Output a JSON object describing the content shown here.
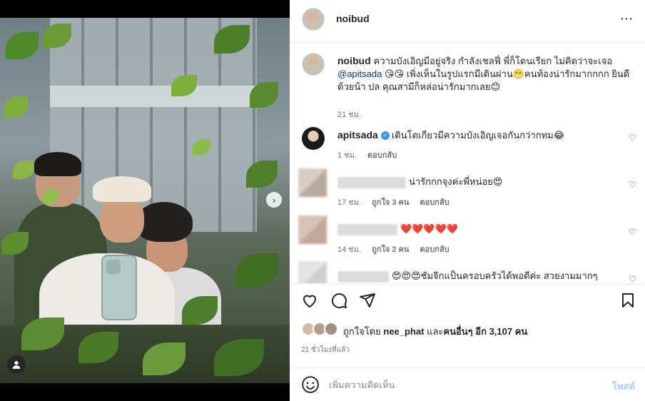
{
  "post": {
    "author": "noibud",
    "more_icon": "⋯"
  },
  "caption": {
    "author": "noibud",
    "text_1": "ความบังเอิญมีอยู่จริง กำลังเชลฟี่ พี่ก็โดนเรียก ไม่คิดว่าจะเจอ",
    "mention": "@apitsada",
    "text_2": "😘😘 เพิ่งเห็นในรูปแรกมีเดินผ่าน😬คนท้องน่ารักมากกกก ยินดีด้วยน้า ปล คุณสามีก็หล่อน่ารักมากเลย😊",
    "time": "21 ชม."
  },
  "comments": [
    {
      "author": "apitsada",
      "verified": true,
      "text": "เดินโตเกียวมีความบังเอิญเจอกันกว่ากทม😂",
      "time": "1 ชม.",
      "reply_label": "ตอบกลับ"
    },
    {
      "author_hidden": true,
      "text": "น่ารักกกจุงค่ะพี่หน่อย😍",
      "time": "17 ชม.",
      "likes": "ถูกใจ 3 คน",
      "reply_label": "ตอบกลับ"
    },
    {
      "author_hidden": true,
      "text": "❤️❤️❤️❤️❤️",
      "time": "14 ชม.",
      "likes": "ถูกใจ 2 คน",
      "reply_label": "ตอบกลับ"
    },
    {
      "author_hidden": true,
      "text": "😍😍😍ชัมจิกแป็นครอบครัวได้พอดีค่ะ สวยงามมากๆ"
    }
  ],
  "likes": {
    "prefix": "ถูกใจโดย",
    "first_user": "nee_phat",
    "middle": "และ",
    "others_label": "คนอื่นๆ อีก 3,107 คน"
  },
  "time_ago": "21 ชั่วโมงที่แล้ว",
  "comment_box": {
    "placeholder": "เพิ่มความคิดเห็น",
    "post_label": "โพสต์"
  },
  "icons": {
    "like": "heart-icon",
    "comment": "comment-icon",
    "share": "share-icon",
    "save": "bookmark-icon",
    "emoji": "emoji-icon",
    "next": "chevron-right-icon",
    "tagged": "user-tag-icon"
  },
  "colors": {
    "link": "#00376b",
    "post_button": "#a7d1f9",
    "verified": "#3897f0"
  }
}
